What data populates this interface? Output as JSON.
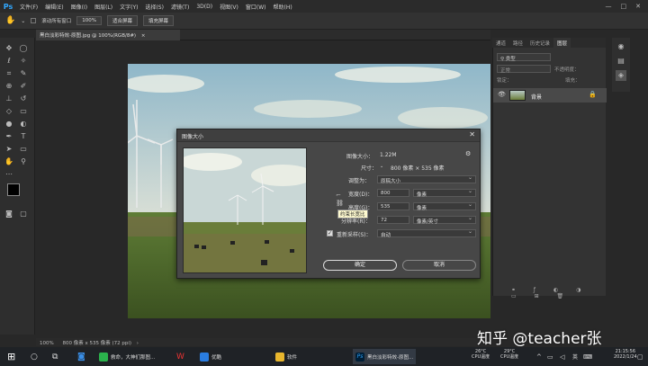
{
  "app": {
    "logo": "Ps"
  },
  "menu": [
    "文件(F)",
    "编辑(E)",
    "图像(I)",
    "图层(L)",
    "文字(Y)",
    "选择(S)",
    "滤镜(T)",
    "3D(D)",
    "视图(V)",
    "窗口(W)",
    "帮助(H)"
  ],
  "window_controls": [
    "—",
    "□",
    "✕"
  ],
  "options": {
    "scroll_all": "滚动所有窗口",
    "zoom": "100%",
    "fit_screen": "适合屏幕",
    "fill_screen": "填充屏幕"
  },
  "document": {
    "tab_title": "黑白淡彩特效-原图.jpg @ 100%(RGB/8#)",
    "tab_close": "×"
  },
  "status": {
    "zoom": "100%",
    "size": "800 像素 x 535 像素 (72 ppi)",
    "arrow": "›"
  },
  "dialog": {
    "title": "图像大小",
    "close": "✕",
    "image_size_label": "图像大小：",
    "image_size_value": "1.22M",
    "dimensions_label": "尺寸：",
    "dimensions_value": "800 像素 × 535 像素",
    "fit_label": "调整为：",
    "fit_value": "原稿大小",
    "width_label": "宽度(D)：",
    "width_value": "800",
    "width_unit": "像素",
    "height_label": "高度(G)：",
    "height_value": "535",
    "height_unit": "像素",
    "resolution_label": "分辨率(R)：",
    "resolution_value": "72",
    "resolution_unit": "像素/英寸",
    "resample_label": "重新采样(S)：",
    "resample_value": "自动",
    "tooltip": "约束长宽比",
    "ok": "确定",
    "cancel": "取消"
  },
  "panels": {
    "tabs": [
      "通道",
      "路径",
      "历史记录",
      "图层"
    ],
    "kind_label": "类型",
    "blend_mode": "正常",
    "opacity_label": "不透明度：",
    "lock_label": "锁定：",
    "fill_label": "填充：",
    "layer_name": "背景"
  },
  "taskbar": {
    "items": [
      "救命，大神们那图…",
      "优酷",
      "软件",
      "黑白淡彩特效-原图..."
    ],
    "gpu_temp": "26°C",
    "gpu_label": "CPU温度",
    "cpu_temp": "29°C",
    "cpu_label": "CPU温度",
    "ime": "英",
    "time": "21:15:56",
    "date": "2022/1/24"
  },
  "watermark": "知乎 @teacher张",
  "colors": {
    "accent": "#31a8ff",
    "dialog_bg": "#474747",
    "ui_bg": "#282828"
  }
}
